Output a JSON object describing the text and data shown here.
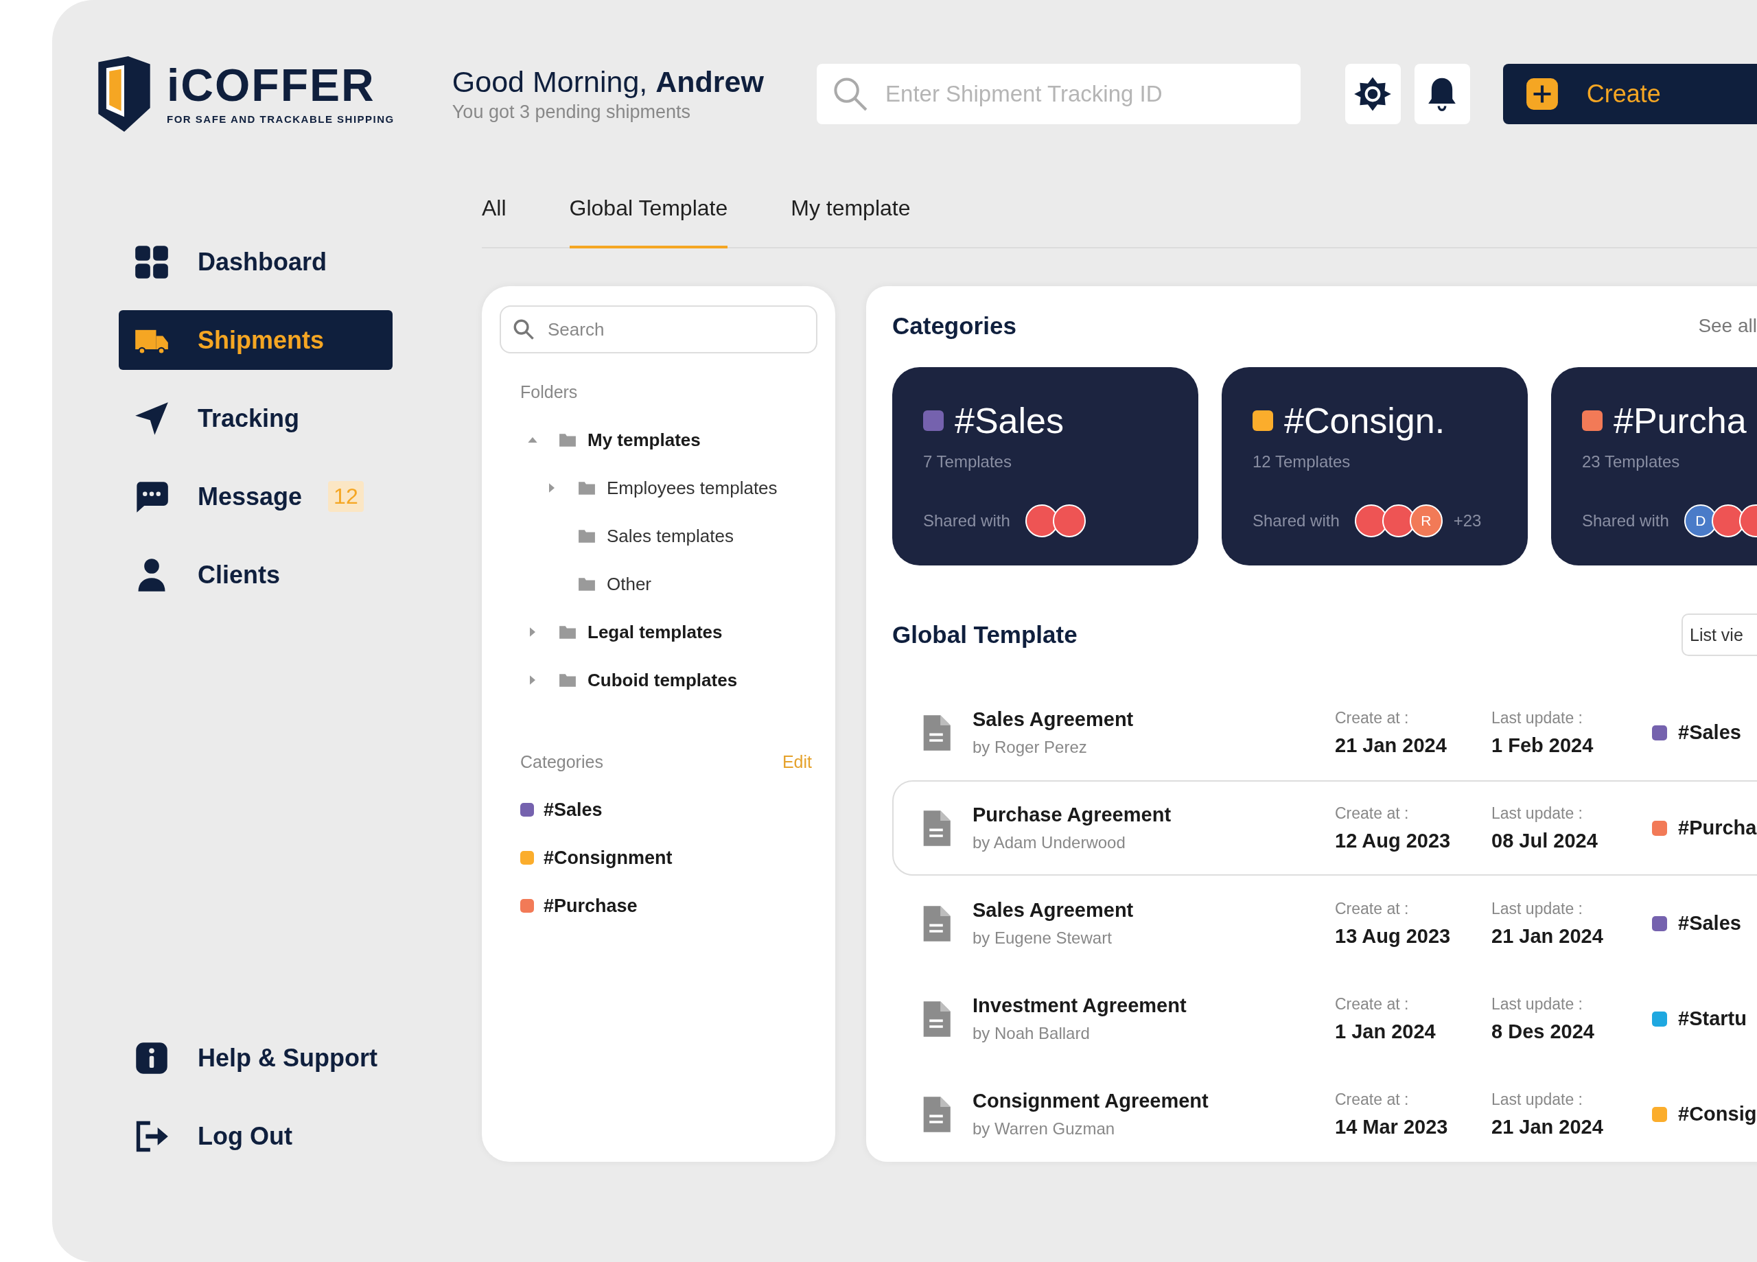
{
  "logo": {
    "name": "iCOFFER",
    "tagline": "FOR SAFE AND TRACKABLE SHIPPING"
  },
  "greeting": {
    "text": "Good Morning, **Andrew**",
    "subtitle": "You got 3 pending shipments"
  },
  "tracking_search": {
    "placeholder": "Enter Shipment Tracking ID"
  },
  "create_button": {
    "label": "Create"
  },
  "sidebar": {
    "items": [
      {
        "label": "Dashboard",
        "kind": "dashboard",
        "selected": false
      },
      {
        "label": "Shipments",
        "kind": "truck",
        "selected": true
      },
      {
        "label": "Tracking",
        "kind": "tracking",
        "selected": false
      },
      {
        "label": "Message",
        "kind": "message",
        "selected": false,
        "badge": "12"
      },
      {
        "label": "Clients",
        "kind": "clients",
        "selected": false
      }
    ],
    "bottom_items": [
      {
        "label": "Help & Support",
        "kind": "help"
      },
      {
        "label": "Log Out",
        "kind": "logout"
      }
    ]
  },
  "tabs": [
    {
      "label": "All",
      "selected": false
    },
    {
      "label": "Global Template",
      "selected": true
    },
    {
      "label": "My template",
      "selected": false
    }
  ],
  "folder_panel": {
    "search": {
      "placeholder": "Search"
    },
    "folders_title": "Folders",
    "folders": [
      {
        "label": "My templates",
        "expanded": true,
        "children": [
          {
            "label": "Employees templates",
            "expanded": false
          },
          {
            "label": "Sales templates"
          },
          {
            "label": "Other"
          }
        ]
      },
      {
        "label": "Legal templates",
        "expanded": false
      },
      {
        "label": "Cuboid templates",
        "expanded": false
      }
    ],
    "categories_title": "Categories",
    "edit_link": "Edit",
    "categories": [
      {
        "label": "#Sales",
        "color": "#7562ae"
      },
      {
        "label": "#Consignment",
        "color": "#fbad2c"
      },
      {
        "label": "#Purchase",
        "color": "#f27a57"
      }
    ]
  },
  "categories_section": {
    "title": "Categories",
    "see_all": "See all",
    "cards": [
      {
        "title": "#Sales",
        "color": "#7562ae",
        "count": "7 Templates",
        "shared_label": "Shared with",
        "avatars": [
          {
            "color": "#ee5454"
          },
          {
            "color": "#ee5454"
          }
        ]
      },
      {
        "title": "#Consign.",
        "color": "#fbad2c",
        "count": "12 Templates",
        "shared_label": "Shared with",
        "avatars": [
          {
            "color": "#ee5454"
          },
          {
            "color": "#ee5454"
          },
          {
            "color": "#f27a57",
            "initial": "R"
          }
        ],
        "extra": "+23"
      },
      {
        "title": "#Purcha",
        "color": "#f27a57",
        "count": "23 Templates",
        "shared_label": "Shared with",
        "avatars": [
          {
            "color": "#4a7bc8",
            "initial": "D"
          },
          {
            "color": "#ee5454"
          },
          {
            "color": "#ee5454"
          }
        ]
      }
    ]
  },
  "global_template": {
    "title": "Global Template",
    "view_button": "List vie",
    "rows": [
      {
        "title": "Sales Agreement",
        "author": "by Roger Perez",
        "created_label": "Create at :",
        "created": "21 Jan 2024",
        "updated_label": "Last update :",
        "updated": "1 Feb 2024",
        "tag": "#Sales",
        "color": "#7562ae",
        "selected": false
      },
      {
        "title": "Purchase Agreement",
        "author": "by Adam Underwood",
        "created_label": "Create at :",
        "created": "12 Aug 2023",
        "updated_label": "Last update :",
        "updated": "08 Jul 2024",
        "tag": "#Purcha",
        "color": "#f27a57",
        "selected": true
      },
      {
        "title": "Sales Agreement",
        "author": "by Eugene Stewart",
        "created_label": "Create at :",
        "created": "13 Aug 2023",
        "updated_label": "Last update :",
        "updated": "21 Jan 2024",
        "tag": "#Sales",
        "color": "#7562ae",
        "selected": false
      },
      {
        "title": "Investment Agreement",
        "author": "by Noah Ballard",
        "created_label": "Create at :",
        "created": "1 Jan 2024",
        "updated_label": "Last update :",
        "updated": "8 Des 2024",
        "tag": "#Startu",
        "color": "#1fa8e0",
        "selected": false
      },
      {
        "title": "Consignment Agreement",
        "author": "by Warren Guzman",
        "created_label": "Create at :",
        "created": "14 Mar 2023",
        "updated_label": "Last update :",
        "updated": "21 Jan 2024",
        "tag": "#Consig",
        "color": "#fbad2c",
        "selected": false
      }
    ]
  }
}
